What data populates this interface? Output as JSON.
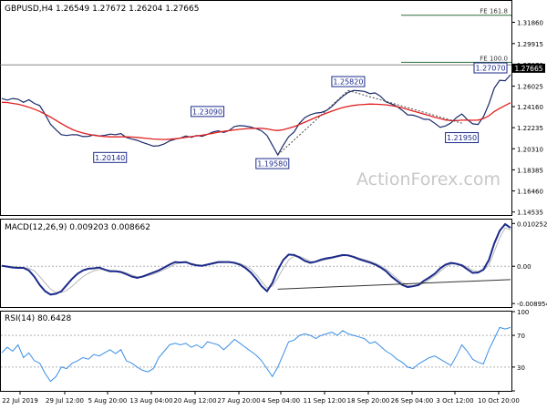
{
  "chart_data": [
    {
      "type": "line",
      "panel": "price",
      "header": "GBPUSD,H4  1.26549 1.27672 1.26204 1.27665",
      "y_ticks": [
        "1.31860",
        "1.29915",
        "1.27970",
        "1.26025",
        "1.24160",
        "1.22235",
        "1.20310",
        "1.18385",
        "1.16460",
        "1.14535"
      ],
      "y_tick_values": [
        1.3186,
        1.29915,
        1.2797,
        1.26025,
        1.2416,
        1.22235,
        1.2031,
        1.18385,
        1.1646,
        1.14535
      ],
      "ylim": [
        1.1426,
        1.3381
      ],
      "last_price_label": "1.27665",
      "last_price": 1.27665,
      "x_ticks": [
        "22 Jul 2019",
        "29 Jul 12:00",
        "5 Aug 20:00",
        "13 Aug 04:00",
        "20 Aug 12:00",
        "27 Aug 20:00",
        "4 Sep 04:00",
        "11 Sep 12:00",
        "18 Sep 20:00",
        "26 Sep 04:00",
        "3 Oct 12:00",
        "10 Oct 20:00"
      ],
      "watermark": "ActionForex.com",
      "series": [
        {
          "name": "",
          "color": "#1b2a6b",
          "values": [
            1.249,
            1.2475,
            1.249,
            1.2483,
            1.2455,
            1.2478,
            1.2445,
            1.2425,
            1.2345,
            1.2255,
            1.2205,
            1.216,
            1.2152,
            1.216,
            1.2158,
            1.2142,
            1.2145,
            1.2157,
            1.2148,
            1.2153,
            1.2165,
            1.216,
            1.217,
            1.2135,
            1.212,
            1.2108,
            1.2089,
            1.2072,
            1.2055,
            1.2058,
            1.2075,
            1.2102,
            1.2118,
            1.2128,
            1.2148,
            1.2135,
            1.2152,
            1.2145,
            1.2162,
            1.2185,
            1.2195,
            1.218,
            1.2198,
            1.2235,
            1.2242,
            1.2238,
            1.2229,
            1.2215,
            1.2195,
            1.2152,
            1.2063,
            1.1975,
            1.2063,
            1.2141,
            1.2185,
            1.2264,
            1.2315,
            1.2342,
            1.2357,
            1.2362,
            1.238,
            1.2418,
            1.2465,
            1.251,
            1.2546,
            1.2563,
            1.2561,
            1.2555,
            1.2535,
            1.2541,
            1.2509,
            1.2458,
            1.244,
            1.2418,
            1.2382,
            1.234,
            1.2338,
            1.2322,
            1.23,
            1.2298,
            1.2264,
            1.2227,
            1.224,
            1.2267,
            1.2315,
            1.2349,
            1.2298,
            1.2259,
            1.2253,
            1.2324,
            1.2441,
            1.2585,
            1.2656,
            1.2652,
            1.2707
          ]
        },
        {
          "name": "",
          "color": "#e02020",
          "values": [
            1.2455,
            1.2453,
            1.2445,
            1.2438,
            1.2425,
            1.241,
            1.2393,
            1.2372,
            1.2347,
            1.232,
            1.229,
            1.226,
            1.2233,
            1.2208,
            1.2189,
            1.2175,
            1.2163,
            1.2154,
            1.2147,
            1.2142,
            1.214,
            1.214,
            1.2141,
            1.214,
            1.2138,
            1.2135,
            1.213,
            1.2125,
            1.212,
            1.2117,
            1.2116,
            1.2118,
            1.2122,
            1.2128,
            1.2135,
            1.2142,
            1.2148,
            1.2155,
            1.2163,
            1.2172,
            1.2182,
            1.219,
            1.2197,
            1.2203,
            1.2209,
            1.2213,
            1.2216,
            1.2217,
            1.2218,
            1.2212,
            1.2203,
            1.2197,
            1.2205,
            1.2219,
            1.2233,
            1.2253,
            1.2274,
            1.2295,
            1.2317,
            1.2337,
            1.2357,
            1.2374,
            1.2392,
            1.2408,
            1.2418,
            1.2427,
            1.2433,
            1.2436,
            1.2439,
            1.2438,
            1.2436,
            1.2432,
            1.2425,
            1.2416,
            1.2404,
            1.239,
            1.2375,
            1.2362,
            1.2348,
            1.2334,
            1.2318,
            1.2307,
            1.2294,
            1.2288,
            1.2289,
            1.2292,
            1.2293,
            1.2291,
            1.2293,
            1.2306,
            1.2332,
            1.2371,
            1.24,
            1.2426,
            1.2452
          ]
        }
      ],
      "annotations": [
        {
          "text": "1.20140",
          "x": 20,
          "y": 1.2014
        },
        {
          "text": "1.23090",
          "x": 38,
          "y": 1.2309
        },
        {
          "text": "1.19580",
          "x": 50,
          "y": 1.1958
        },
        {
          "text": "1.25820",
          "x": 64,
          "y": 1.2582
        },
        {
          "text": "1.21950",
          "x": 85,
          "y": 1.2195
        },
        {
          "text": "1.27070",
          "x": 94,
          "y": 1.2707
        }
      ],
      "fibonacci": [
        {
          "text": "FE 161.8",
          "y": 1.325
        },
        {
          "text": "FE 100.0",
          "y": 1.2821
        }
      ]
    },
    {
      "type": "line",
      "panel": "macd",
      "header": "MACD(12,26,9) 0.009203 0.008662",
      "y_ticks": [
        "0.010252",
        "0.00",
        "-0.008954"
      ],
      "y_tick_values": [
        0.010252,
        0,
        -0.008954
      ],
      "ylim": [
        -0.0098,
        0.0112
      ],
      "series": [
        {
          "name": "",
          "color": "#1b2a8a",
          "values": [
            0.0001,
            -0.0001,
            -0.0003,
            -0.0004,
            -0.0004,
            -0.001,
            -0.0025,
            -0.0045,
            -0.006,
            -0.0068,
            -0.0066,
            -0.006,
            -0.0045,
            -0.003,
            -0.0018,
            -0.001,
            -0.0006,
            -0.0005,
            -0.0003,
            -0.0008,
            -0.0012,
            -0.0012,
            -0.0014,
            -0.0019,
            -0.0025,
            -0.0028,
            -0.0025,
            -0.002,
            -0.0015,
            -0.001,
            -0.0003,
            0.0004,
            0.001,
            0.0009,
            0.001,
            0.0005,
            0.0002,
            0.0001,
            0.0004,
            0.0007,
            0.001,
            0.001,
            0.001,
            0.0008,
            0.0004,
            -0.0004,
            -0.0015,
            -0.003,
            -0.0048,
            -0.006,
            -0.004,
            -0.0009,
            0.0015,
            0.0028,
            0.0027,
            0.0021,
            0.0013,
            0.0008,
            0.0011,
            0.0016,
            0.0019,
            0.0021,
            0.0024,
            0.0027,
            0.0026,
            0.0022,
            0.0017,
            0.0013,
            0.0009,
            0.0004,
            -0.0003,
            -0.0012,
            -0.0025,
            -0.0035,
            -0.0045,
            -0.005,
            -0.0048,
            -0.0045,
            -0.0035,
            -0.0027,
            -0.0018,
            -0.0005,
            0.0004,
            0.0008,
            0.0006,
            0.0002,
            -0.0007,
            -0.0016,
            -0.0015,
            -0.0008,
            0.0015,
            0.0055,
            0.0085,
            0.0101,
            0.0092
          ]
        },
        {
          "name": "",
          "color": "#b8b8b8",
          "values": [
            0.0002,
            0.0001,
            -0.0001,
            -0.0002,
            -0.0003,
            -0.0005,
            -0.0011,
            -0.0025,
            -0.004,
            -0.0055,
            -0.0063,
            -0.0063,
            -0.0058,
            -0.0048,
            -0.0036,
            -0.0025,
            -0.0017,
            -0.0011,
            -0.0008,
            -0.0008,
            -0.001,
            -0.0011,
            -0.0012,
            -0.0016,
            -0.0021,
            -0.0025,
            -0.0026,
            -0.0023,
            -0.0019,
            -0.0014,
            -0.0008,
            -0.0002,
            0.0005,
            0.0008,
            0.0009,
            0.0007,
            0.0004,
            0.0002,
            0.0003,
            0.0005,
            0.0008,
            0.0009,
            0.001,
            0.0009,
            0.0006,
            0.0001,
            -0.0007,
            -0.002,
            -0.0036,
            -0.0052,
            -0.0048,
            -0.0028,
            -0.0005,
            0.0015,
            0.0024,
            0.0024,
            0.0018,
            0.0012,
            0.001,
            0.0013,
            0.0016,
            0.0019,
            0.0022,
            0.0025,
            0.0026,
            0.0024,
            0.002,
            0.0016,
            0.0012,
            0.0007,
            0.0001,
            -0.0007,
            -0.0018,
            -0.0029,
            -0.0039,
            -0.0046,
            -0.0048,
            -0.0046,
            -0.004,
            -0.0032,
            -0.0023,
            -0.0012,
            -0.0002,
            0.0005,
            0.0006,
            0.0004,
            -0.0002,
            -0.001,
            -0.0013,
            -0.001,
            0.0003,
            0.0035,
            0.0068,
            0.0092,
            0.0087
          ]
        }
      ]
    },
    {
      "type": "line",
      "panel": "rsi",
      "header": "RSI(14) 80.6428",
      "y_ticks": [
        "100",
        "70",
        "30",
        "0"
      ],
      "y_tick_values": [
        100,
        70,
        30,
        0
      ],
      "ylim": [
        0,
        100
      ],
      "series": [
        {
          "name": "",
          "color": "#3a8fe6",
          "values": [
            48,
            55,
            50,
            58,
            42,
            48,
            38,
            35,
            22,
            12,
            18,
            30,
            28,
            35,
            38,
            42,
            40,
            46,
            44,
            48,
            52,
            47,
            52,
            38,
            35,
            30,
            26,
            24,
            28,
            42,
            50,
            58,
            60,
            58,
            60,
            55,
            58,
            54,
            62,
            60,
            58,
            52,
            58,
            65,
            60,
            55,
            50,
            45,
            38,
            28,
            18,
            30,
            46,
            62,
            64,
            70,
            72,
            70,
            66,
            70,
            72,
            74,
            70,
            76,
            72,
            70,
            68,
            66,
            60,
            62,
            56,
            50,
            46,
            40,
            36,
            30,
            28,
            34,
            38,
            42,
            44,
            40,
            36,
            32,
            44,
            58,
            50,
            40,
            36,
            34,
            52,
            66,
            80,
            78,
            80
          ]
        }
      ]
    }
  ]
}
